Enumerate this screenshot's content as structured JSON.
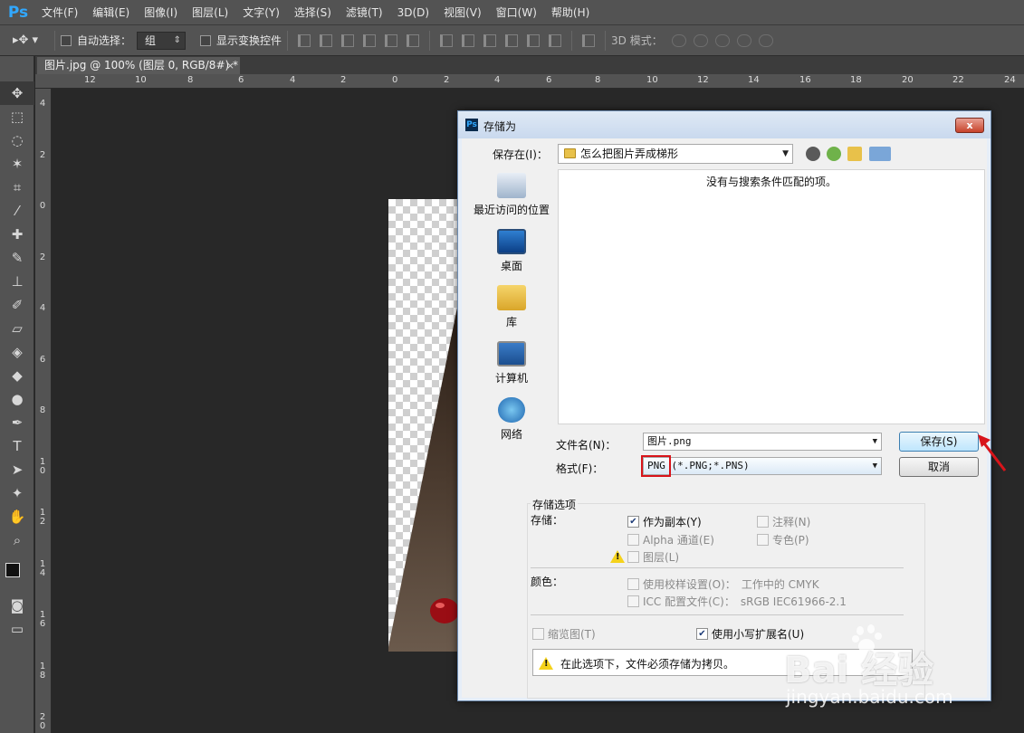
{
  "app": {
    "logo": "Ps"
  },
  "menu": [
    "文件(F)",
    "编辑(E)",
    "图像(I)",
    "图层(L)",
    "文字(Y)",
    "选择(S)",
    "滤镜(T)",
    "3D(D)",
    "视图(V)",
    "窗口(W)",
    "帮助(H)"
  ],
  "options_bar": {
    "auto_select_label": "自动选择：",
    "auto_select_value": "组",
    "show_transform_label": "显示变换控件",
    "mode_3d_label": "3D 模式："
  },
  "document_tab": {
    "title": "图片.jpg @ 100% (图层 0, RGB/8#) *",
    "close": "×"
  },
  "ruler": {
    "top": [
      "12",
      "10",
      "8",
      "6",
      "4",
      "2",
      "0",
      "2",
      "4",
      "6",
      "8",
      "10",
      "12",
      "14",
      "16",
      "18",
      "20",
      "22",
      "24"
    ],
    "left": [
      "4",
      "2",
      "0",
      "2",
      "4",
      "6",
      "8",
      "1\n0",
      "1\n2",
      "1\n4",
      "1\n6",
      "1\n8",
      "2\n0"
    ]
  },
  "dialog": {
    "title": "存储为",
    "close": "x",
    "save_in_label": "保存在(I)：",
    "save_in_value": "怎么把图片弄成梯形",
    "places": [
      "最近访问的位置",
      "桌面",
      "库",
      "计算机",
      "网络"
    ],
    "empty_message": "没有与搜索条件匹配的项。",
    "filename_label": "文件名(N)：",
    "filename_value": "图片.png",
    "format_label": "格式(F)：",
    "format_value": "PNG (*.PNG;*.PNS)",
    "save_button": "保存(S)",
    "cancel_button": "取消",
    "options": {
      "group_title": "存储选项",
      "save_label": "存储：",
      "as_copy": "作为副本(Y)",
      "notes": "注释(N)",
      "alpha": "Alpha 通道(E)",
      "spot": "专色(P)",
      "layers": "图层(L)",
      "color_label": "颜色：",
      "proof": "使用校样设置(O)：",
      "proof_value": "工作中的 CMYK",
      "icc": "ICC 配置文件(C)：",
      "icc_value": "sRGB IEC61966-2.1",
      "thumbnail": "缩览图(T)",
      "lowercase_ext": "使用小写扩展名(U)",
      "warning": "在此选项下，文件必须存储为拷贝。"
    }
  },
  "watermark": {
    "brand": "Bai 经验",
    "site": "jingyan.baidu.com"
  },
  "colors": {
    "accent": "#31a8ff",
    "highlight_red": "#d8141a",
    "ui_gray": "#535353"
  }
}
